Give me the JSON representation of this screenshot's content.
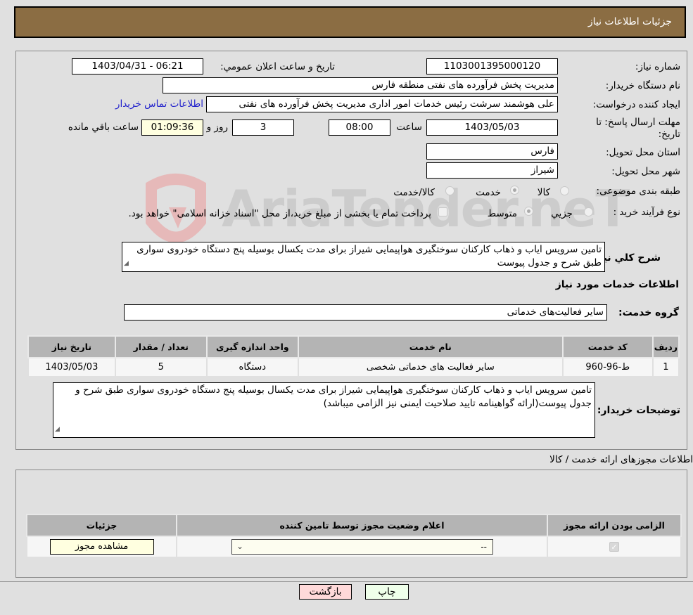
{
  "header": {
    "title": "جزئیات اطلاعات نیاز"
  },
  "form": {
    "need_number_label": "شماره نیاز:",
    "need_number": "1103001395000120",
    "announce_label": "تاریخ و ساعت اعلان عمومي:",
    "announce_value": "1403/04/31 - 06:21",
    "buyer_org_label": "نام دستگاه خریدار:",
    "buyer_org": "مدیریت پخش فرآورده های نفتی منطقه فارس",
    "creator_label": "ایجاد کننده درخواست:",
    "creator": "علی هوشمند سرشت رئیس خدمات امور اداری مدیریت پخش فرآورده های نفتی",
    "contact_link": "اطلاعات تماس خریدار",
    "deadline_label_1": "مهلت ارسال پاسخ: تا",
    "deadline_label_2": "تاریخ:",
    "deadline_date": "1403/05/03",
    "time_label": "ساعت",
    "deadline_time": "08:00",
    "days_value": "3",
    "days_label": "روز و",
    "remaining_time": "01:09:36",
    "remaining_label": "ساعت باقي مانده",
    "province_label": "استان محل تحویل:",
    "province": "فارس",
    "city_label": "شهر محل تحویل:",
    "city": "شیراز",
    "category_label": "طبقه بندی موضوعی:",
    "category_options": [
      {
        "label": "کالا",
        "checked": false
      },
      {
        "label": "خدمت",
        "checked": true
      },
      {
        "label": "کالا/خدمت",
        "checked": false
      }
    ],
    "process_label": "نوع فرآیند خرید :",
    "process_options": [
      {
        "label": "جزيي",
        "checked": false
      },
      {
        "label": "متوسط",
        "checked": true
      }
    ],
    "treasury_note": "پرداخت تمام یا بخشی از مبلغ خرید،از محل \"اسناد خزانه اسلامی\" خواهد بود.",
    "description_label": "شرح کلي نیاز:",
    "description": "تامین سرویس ایاب و ذهاب کارکنان سوختگیری هواپیمایی شیراز برای مدت یکسال بوسیله پنج دستگاه خودروی سواری طبق شرح و جدول پیوست",
    "services_heading": "اطلاعات خدمات مورد نیاز",
    "service_group_label": "گروه خدمت:",
    "service_group": "سایر فعالیت‌های خدماتی"
  },
  "services_table": {
    "headers": [
      "ردیف",
      "کد خدمت",
      "نام خدمت",
      "واحد اندازه گیری",
      "تعداد / مقدار",
      "تاریخ نیاز"
    ],
    "rows": [
      [
        "1",
        "ط-96-960",
        "سایر فعالیت های خدماتی شخصی",
        "دستگاه",
        "5",
        "1403/05/03"
      ]
    ]
  },
  "buyer_notes": {
    "label": "توضیحات خریدار:",
    "text": "تامین سرویس ایاب و ذهاب کارکنان سوختگیری هواپیمایی شیراز برای مدت یکسال بوسیله پنج دستگاه خودروی سواری طبق شرح و جدول پیوست(ارائه گواهینامه تایید صلاحیت ایمنی نیز الزامی میباشد)"
  },
  "permits": {
    "title": "اطلاعات مجوزهای ارائه خدمت / کالا",
    "headers": [
      "الزامی بودن ارائه مجوز",
      "اعلام وضعیت مجوز توسط تامین کننده",
      "جزئیات"
    ],
    "required_checked": true,
    "status_selected": "--",
    "view_button": "مشاهده مجوز"
  },
  "buttons": {
    "print": "چاپ",
    "back": "بازگشت"
  },
  "watermark": {
    "text": "AriaTender.neT"
  },
  "colors": {
    "header_bg": "#8b6d43",
    "print_bg": "#efffea",
    "back_bg": "#ffd9d9",
    "link": "#2222cc"
  }
}
